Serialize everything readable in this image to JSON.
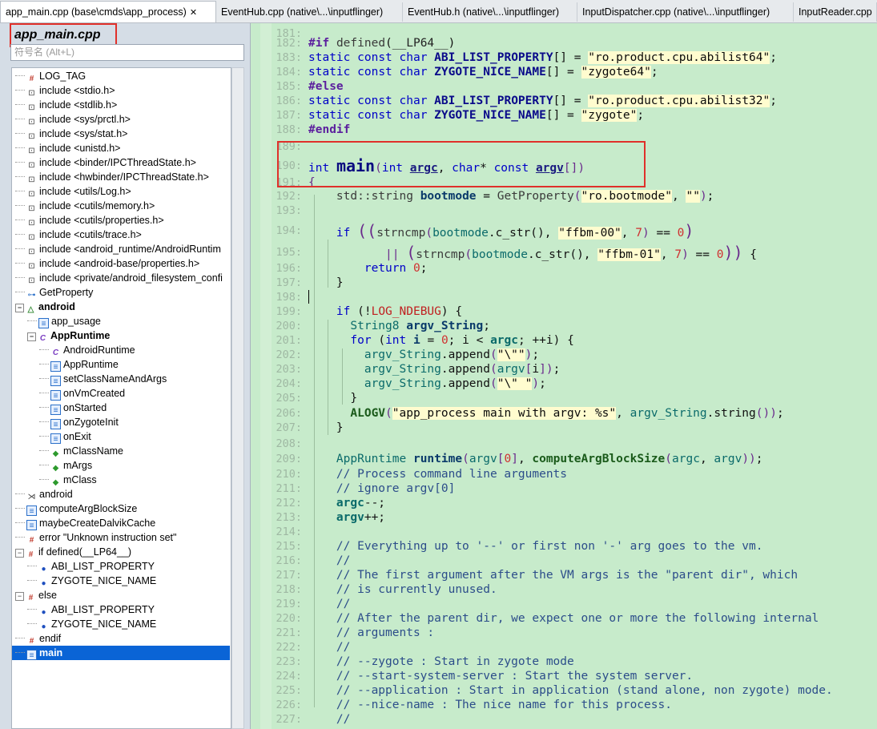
{
  "tabs": [
    {
      "label": "app_main.cpp (base\\cmds\\app_process)",
      "close": "✕",
      "active": true
    },
    {
      "label": "EventHub.cpp (native\\...\\inputflinger)",
      "active": false
    },
    {
      "label": "EventHub.h (native\\...\\inputflinger)",
      "active": false
    },
    {
      "label": "InputDispatcher.cpp (native\\...\\inputflinger)",
      "active": false
    },
    {
      "label": "InputReader.cpp",
      "active": false
    }
  ],
  "left": {
    "file_title": "app_main.cpp",
    "search_placeholder": "符号名 (Alt+L)",
    "tree": [
      {
        "label": "LOG_TAG",
        "icon": "hash-icon"
      },
      {
        "label": "include <stdio.h>",
        "icon": "include-icon"
      },
      {
        "label": "include <stdlib.h>",
        "icon": "include-icon"
      },
      {
        "label": "include <sys/prctl.h>",
        "icon": "include-icon"
      },
      {
        "label": "include <sys/stat.h>",
        "icon": "include-icon"
      },
      {
        "label": "include <unistd.h>",
        "icon": "include-icon"
      },
      {
        "label": "include <binder/IPCThreadState.h>",
        "icon": "include-icon"
      },
      {
        "label": "include <hwbinder/IPCThreadState.h>",
        "icon": "include-icon"
      },
      {
        "label": "include <utils/Log.h>",
        "icon": "include-icon"
      },
      {
        "label": "include <cutils/memory.h>",
        "icon": "include-icon"
      },
      {
        "label": "include <cutils/properties.h>",
        "icon": "include-icon"
      },
      {
        "label": "include <cutils/trace.h>",
        "icon": "include-icon"
      },
      {
        "label": "include <android_runtime/AndroidRuntim",
        "icon": "include-icon"
      },
      {
        "label": "include <android-base/properties.h>",
        "icon": "include-icon"
      },
      {
        "label": "include <private/android_filesystem_confi",
        "icon": "include-icon"
      },
      {
        "label": "GetProperty",
        "icon": "link-icon"
      },
      {
        "label": "android",
        "icon": "namespace-icon",
        "bold": true,
        "expander": "−"
      },
      {
        "label": "app_usage",
        "icon": "function-icon",
        "indent": 1
      },
      {
        "label": "AppRuntime",
        "icon": "class-icon",
        "bold": true,
        "indent": 1,
        "expander": "−"
      },
      {
        "label": "AndroidRuntime",
        "icon": "class-icon",
        "indent": 2
      },
      {
        "label": "AppRuntime",
        "icon": "function-icon",
        "indent": 2
      },
      {
        "label": "setClassNameAndArgs",
        "icon": "function-icon",
        "indent": 2
      },
      {
        "label": "onVmCreated",
        "icon": "function-icon",
        "indent": 2
      },
      {
        "label": "onStarted",
        "icon": "function-icon",
        "indent": 2
      },
      {
        "label": "onZygoteInit",
        "icon": "function-icon",
        "indent": 2
      },
      {
        "label": "onExit",
        "icon": "function-icon",
        "indent": 2
      },
      {
        "label": "mClassName",
        "icon": "field-icon",
        "indent": 2
      },
      {
        "label": "mArgs",
        "icon": "field-icon",
        "indent": 2
      },
      {
        "label": "mClass",
        "icon": "field-icon",
        "indent": 2
      },
      {
        "label": "android",
        "icon": "using-icon"
      },
      {
        "label": "computeArgBlockSize",
        "icon": "function-icon"
      },
      {
        "label": "maybeCreateDalvikCache",
        "icon": "function-icon"
      },
      {
        "label": "error \"Unknown instruction set\"",
        "icon": "hash-icon"
      },
      {
        "label": "if defined(__LP64__)",
        "icon": "hash-icon",
        "expander": "−"
      },
      {
        "label": "ABI_LIST_PROPERTY",
        "icon": "variable-icon",
        "indent": 1
      },
      {
        "label": "ZYGOTE_NICE_NAME",
        "icon": "variable-icon",
        "indent": 1
      },
      {
        "label": "else",
        "icon": "hash-icon",
        "expander": "−"
      },
      {
        "label": "ABI_LIST_PROPERTY",
        "icon": "variable-icon",
        "indent": 1
      },
      {
        "label": "ZYGOTE_NICE_NAME",
        "icon": "variable-icon",
        "indent": 1
      },
      {
        "label": "endif",
        "icon": "hash-icon"
      },
      {
        "label": "main",
        "icon": "function-icon",
        "bold": true,
        "selected": true
      }
    ]
  },
  "editor": {
    "line_numbers": [
      "181:",
      "182:",
      "183:",
      "184:",
      "185:",
      "186:",
      "187:",
      "188:",
      "189:",
      "190:",
      "191:",
      "192:",
      "193:",
      "194:",
      "195:",
      "196:",
      "197:",
      "198:",
      "199:",
      "200:",
      "201:",
      "202:",
      "203:",
      "204:",
      "205:",
      "206:",
      "207:",
      "208:",
      "209:",
      "210:",
      "211:",
      "212:",
      "213:",
      "214:",
      "215:",
      "216:",
      "217:",
      "218:",
      "219:",
      "220:",
      "221:",
      "222:",
      "223:",
      "224:",
      "225:",
      "226:",
      "227:"
    ],
    "comments": {
      "c210": "// Process command line arguments",
      "c211": "// ignore argv[0]",
      "c215": "// Everything up to '--' or first non '-' arg goes to the vm.",
      "c216": "//",
      "c217": "// The first argument after the VM args is the \"parent dir\", which",
      "c218": "// is currently unused.",
      "c219": "//",
      "c220": "// After the parent dir, we expect one or more the following internal",
      "c221": "// arguments :",
      "c222": "//",
      "c223": "// --zygote : Start in zygote mode",
      "c224": "// --start-system-server : Start the system server.",
      "c225": "// --application : Start in application (stand alone, non zygote) mode.",
      "c226": "// --nice-name : The nice name for this process.",
      "c227": "//"
    },
    "strings": {
      "abi64": "\"ro.product.cpu.abilist64\"",
      "zyg64": "\"zygote64\"",
      "abi32": "\"ro.product.cpu.abilist32\"",
      "zyg": "\"zygote\"",
      "bootmode": "\"ro.bootmode\"",
      "empty": "\"\"",
      "ffbm00": "\"ffbm-00\"",
      "ffbm01": "\"ffbm-01\"",
      "q1": "\"\\\"\"",
      "q2": "\"\\\" \"",
      "fmt": "\"app_process main with argv: %s\""
    }
  },
  "colors": {
    "editor_bg": "#c7ebcb",
    "selection": "#0a64d6",
    "highlight_box": "#e0302a"
  }
}
